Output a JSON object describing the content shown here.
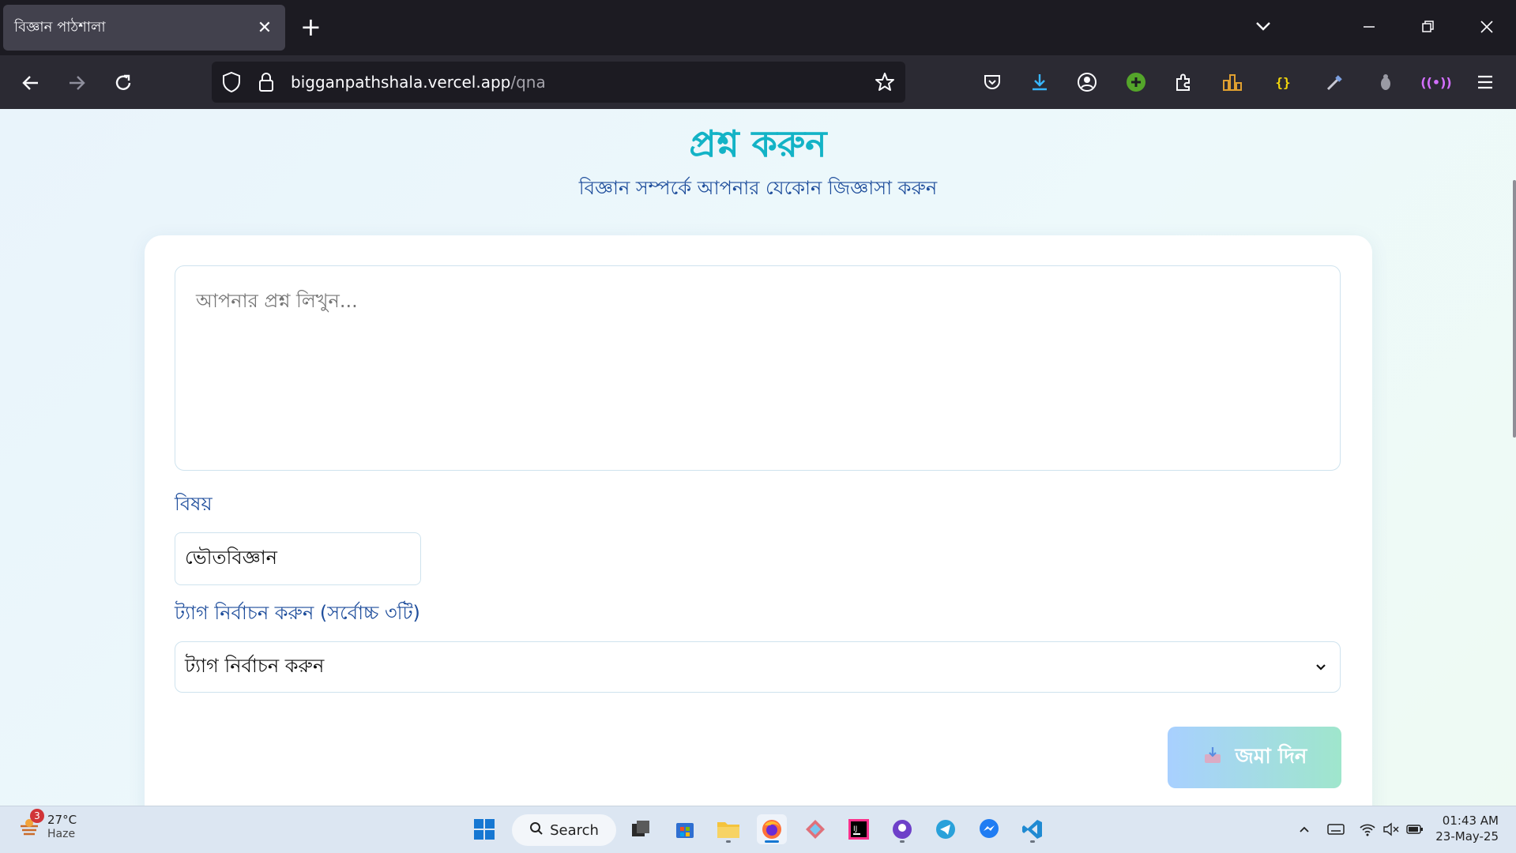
{
  "browser": {
    "tab_title": "বিজ্ঞান পাঠশালা",
    "url_host": "bigganpathshala.vercel.app",
    "url_path": "/qna"
  },
  "page": {
    "title": "প্রশ্ন করুন",
    "subtitle": "বিজ্ঞান সম্পর্কে আপনার যেকোন জিজ্ঞাসা করুন",
    "question_placeholder": "আপনার প্রশ্ন লিখুন...",
    "subject_label": "বিষয়",
    "subject_value": "ভৌতবিজ্ঞান",
    "tags_label": "ট্যাগ নির্বাচন করুন (সর্বোচ্চ ৩টি)",
    "tags_selected": "ট্যাগ নির্বাচন করুন",
    "submit_label": "জমা দিন"
  },
  "taskbar": {
    "weather_temp": "27°C",
    "weather_condition": "Haze",
    "weather_badge": "3",
    "search_label": "Search",
    "time": "01:43 AM",
    "date": "23-May-25"
  },
  "colors": {
    "title": "#13b3c6",
    "subtitle": "#1f4e9c",
    "chrome_dark": "#1c1b22",
    "toolbar": "#2b2a33"
  }
}
